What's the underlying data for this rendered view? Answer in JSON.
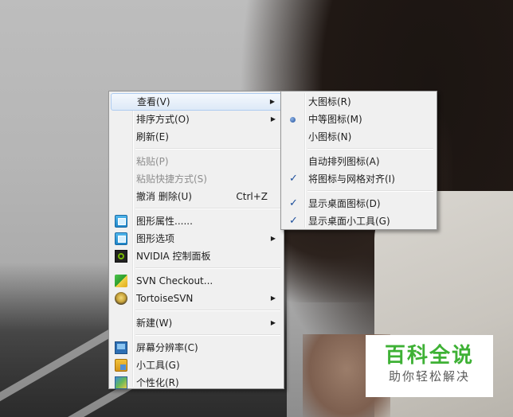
{
  "main_menu": {
    "items": [
      {
        "label": "查看(V)",
        "has_submenu": true
      },
      {
        "label": "排序方式(O)",
        "has_submenu": true
      },
      {
        "label": "刷新(E)"
      },
      {
        "label": "粘贴(P)",
        "disabled": true
      },
      {
        "label": "粘贴快捷方式(S)",
        "disabled": true
      },
      {
        "label": "撤消 删除(U)",
        "shortcut": "Ctrl+Z"
      },
      {
        "label": "图形属性......",
        "icon": "graphics-properties-icon"
      },
      {
        "label": "图形选项",
        "icon": "graphics-options-icon",
        "has_submenu": true
      },
      {
        "label": "NVIDIA 控制面板",
        "icon": "nvidia-icon"
      },
      {
        "label": "SVN Checkout...",
        "icon": "svn-checkout-icon"
      },
      {
        "label": "TortoiseSVN",
        "icon": "tortoisesvn-icon",
        "has_submenu": true
      },
      {
        "label": "新建(W)",
        "has_submenu": true
      },
      {
        "label": "屏幕分辨率(C)",
        "icon": "screen-resolution-icon"
      },
      {
        "label": "小工具(G)",
        "icon": "gadgets-icon"
      },
      {
        "label": "个性化(R)",
        "icon": "personalize-icon"
      }
    ]
  },
  "view_submenu": {
    "items": [
      {
        "label": "大图标(R)"
      },
      {
        "label": "中等图标(M)",
        "selected": true
      },
      {
        "label": "小图标(N)"
      },
      {
        "label": "自动排列图标(A)"
      },
      {
        "label": "将图标与网格对齐(I)",
        "checked": true
      },
      {
        "label": "显示桌面图标(D)",
        "checked": true
      },
      {
        "label": "显示桌面小工具(G)",
        "checked": true
      }
    ]
  },
  "symbols": {
    "arrow": "▶",
    "check": "✓"
  },
  "watermark": {
    "title": "百科全说",
    "subtitle": "助你轻松解决"
  },
  "colors": {
    "menu_bg": "#f0f0f0",
    "hover_border": "#aeccf1",
    "watermark_green": "#3eb135"
  }
}
